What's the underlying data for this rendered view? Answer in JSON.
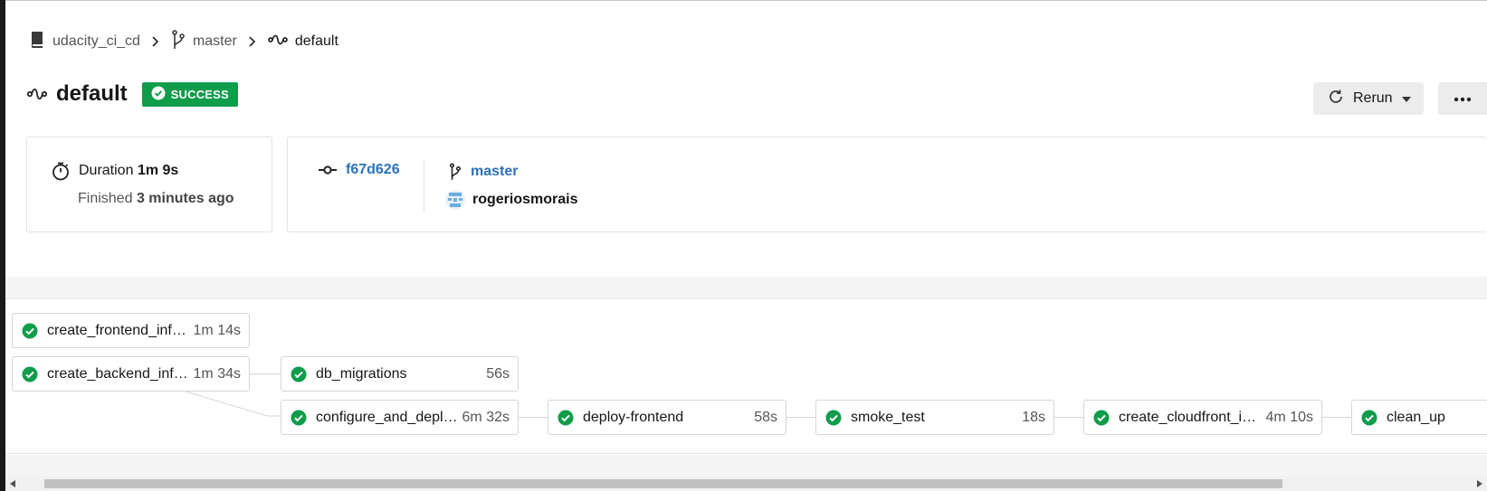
{
  "breadcrumb": {
    "project": "udacity_ci_cd",
    "branch": "master",
    "workflow": "default"
  },
  "header": {
    "title": "default",
    "status": "SUCCESS",
    "rerun_label": "Rerun"
  },
  "summary": {
    "duration_label": "Duration",
    "duration_value": "1m 9s",
    "finished_label": "Finished",
    "finished_value": "3 minutes ago",
    "commit": "f67d626",
    "branch": "master",
    "user": "rogeriosmorais"
  },
  "jobs": [
    {
      "name": "create_frontend_infra...",
      "time": "1m 14s",
      "status": "success"
    },
    {
      "name": "create_backend_infra...",
      "time": "1m 34s",
      "status": "success"
    },
    {
      "name": "db_migrations",
      "time": "56s",
      "status": "success"
    },
    {
      "name": "configure_and_deplo...",
      "time": "6m 32s",
      "status": "success"
    },
    {
      "name": "deploy-frontend",
      "time": "58s",
      "status": "success"
    },
    {
      "name": "smoke_test",
      "time": "18s",
      "status": "success"
    },
    {
      "name": "create_cloudfront_inf...",
      "time": "4m 10s",
      "status": "success"
    },
    {
      "name": "clean_up",
      "time": "",
      "status": "success"
    }
  ],
  "colors": {
    "success": "#0f9d4a",
    "link": "#2b72b8"
  },
  "icons": {
    "project": "book-icon",
    "branch": "git-branch-icon",
    "workflow": "workflow-icon",
    "duration": "stopwatch-icon",
    "commit": "git-commit-icon",
    "rerun": "refresh-icon",
    "more": "ellipsis-icon",
    "job_status": "check-circle-icon"
  }
}
